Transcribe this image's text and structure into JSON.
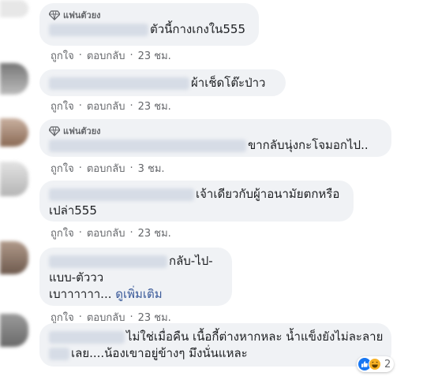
{
  "badge_label": "แฟนตัวยง",
  "actions": {
    "like": "ถูกใจ",
    "reply": "ตอบกลับ",
    "separator": "·"
  },
  "comments": [
    {
      "lines": [
        "ตัวนี้กางเกงใน555"
      ],
      "time": "23 ชม.",
      "badge": true
    },
    {
      "lines": [
        "ผ้าเช็ดโต๊ะป่าว"
      ],
      "time": "23 ชม.",
      "badge": false
    },
    {
      "lines": [
        "ขากลับนุ่งกะโจมอกไป.."
      ],
      "time": "3 ชม.",
      "badge": true
    },
    {
      "lines": [
        "เจ้าเดียวกับผู้าอนามัยตกหรือ",
        "เปล่า555"
      ],
      "time": "23 ชม.",
      "badge": false
    },
    {
      "lines": [
        "กลับ-ไป-",
        "แบบ-ตัววว",
        "เบาาาาาา..."
      ],
      "see_more": "ดูเพิ่มเติม",
      "time": "23 ชม.",
      "badge": false
    },
    {
      "lines": [
        "ไม่ใช่เมื่อคืน เนื้อกี้ต่างหากหละ น้ำแข็งยังไม่ละลาย",
        "เลย....น้องเขาอยู่ข้างๆ มึงนั่นแหละ"
      ],
      "reaction_count": "2",
      "badge": false
    }
  ],
  "colors": {
    "bubble": "#f0f2f5",
    "meta": "#65676b",
    "link": "#385898",
    "like_blue": "#1877f2",
    "haha_yellow": "#f7b125"
  }
}
